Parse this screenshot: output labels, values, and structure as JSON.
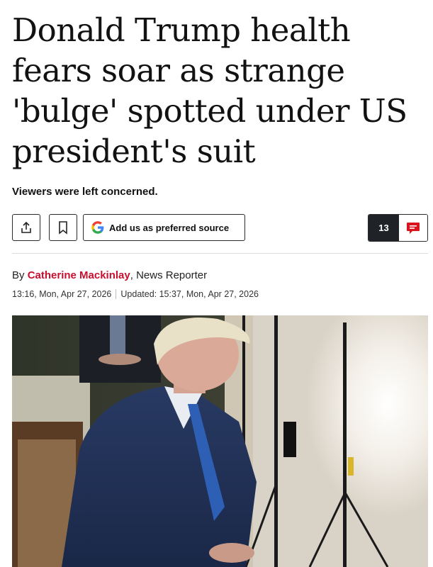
{
  "article": {
    "headline": "Donald Trump health fears soar as strange 'bulge' spotted under US president's suit",
    "standfirst": "Viewers were left concerned.",
    "byline_prefix": "By ",
    "author": "Catherine Mackinlay",
    "author_role": ", News Reporter",
    "published": "13:16, Mon, Apr 27, 2026",
    "updated": "Updated: 15:37, Mon, Apr 27, 2026"
  },
  "toolbar": {
    "share_icon": "share-icon",
    "bookmark_icon": "bookmark-icon",
    "source_label": "Add us as preferred source",
    "google_icon": "google-g-icon",
    "comment_count": "13",
    "comment_icon": "comment-bubble-icon"
  },
  "colors": {
    "author": "#c8102e",
    "comment_count_bg": "#1f2226",
    "comment_icon": "#d9141e"
  }
}
